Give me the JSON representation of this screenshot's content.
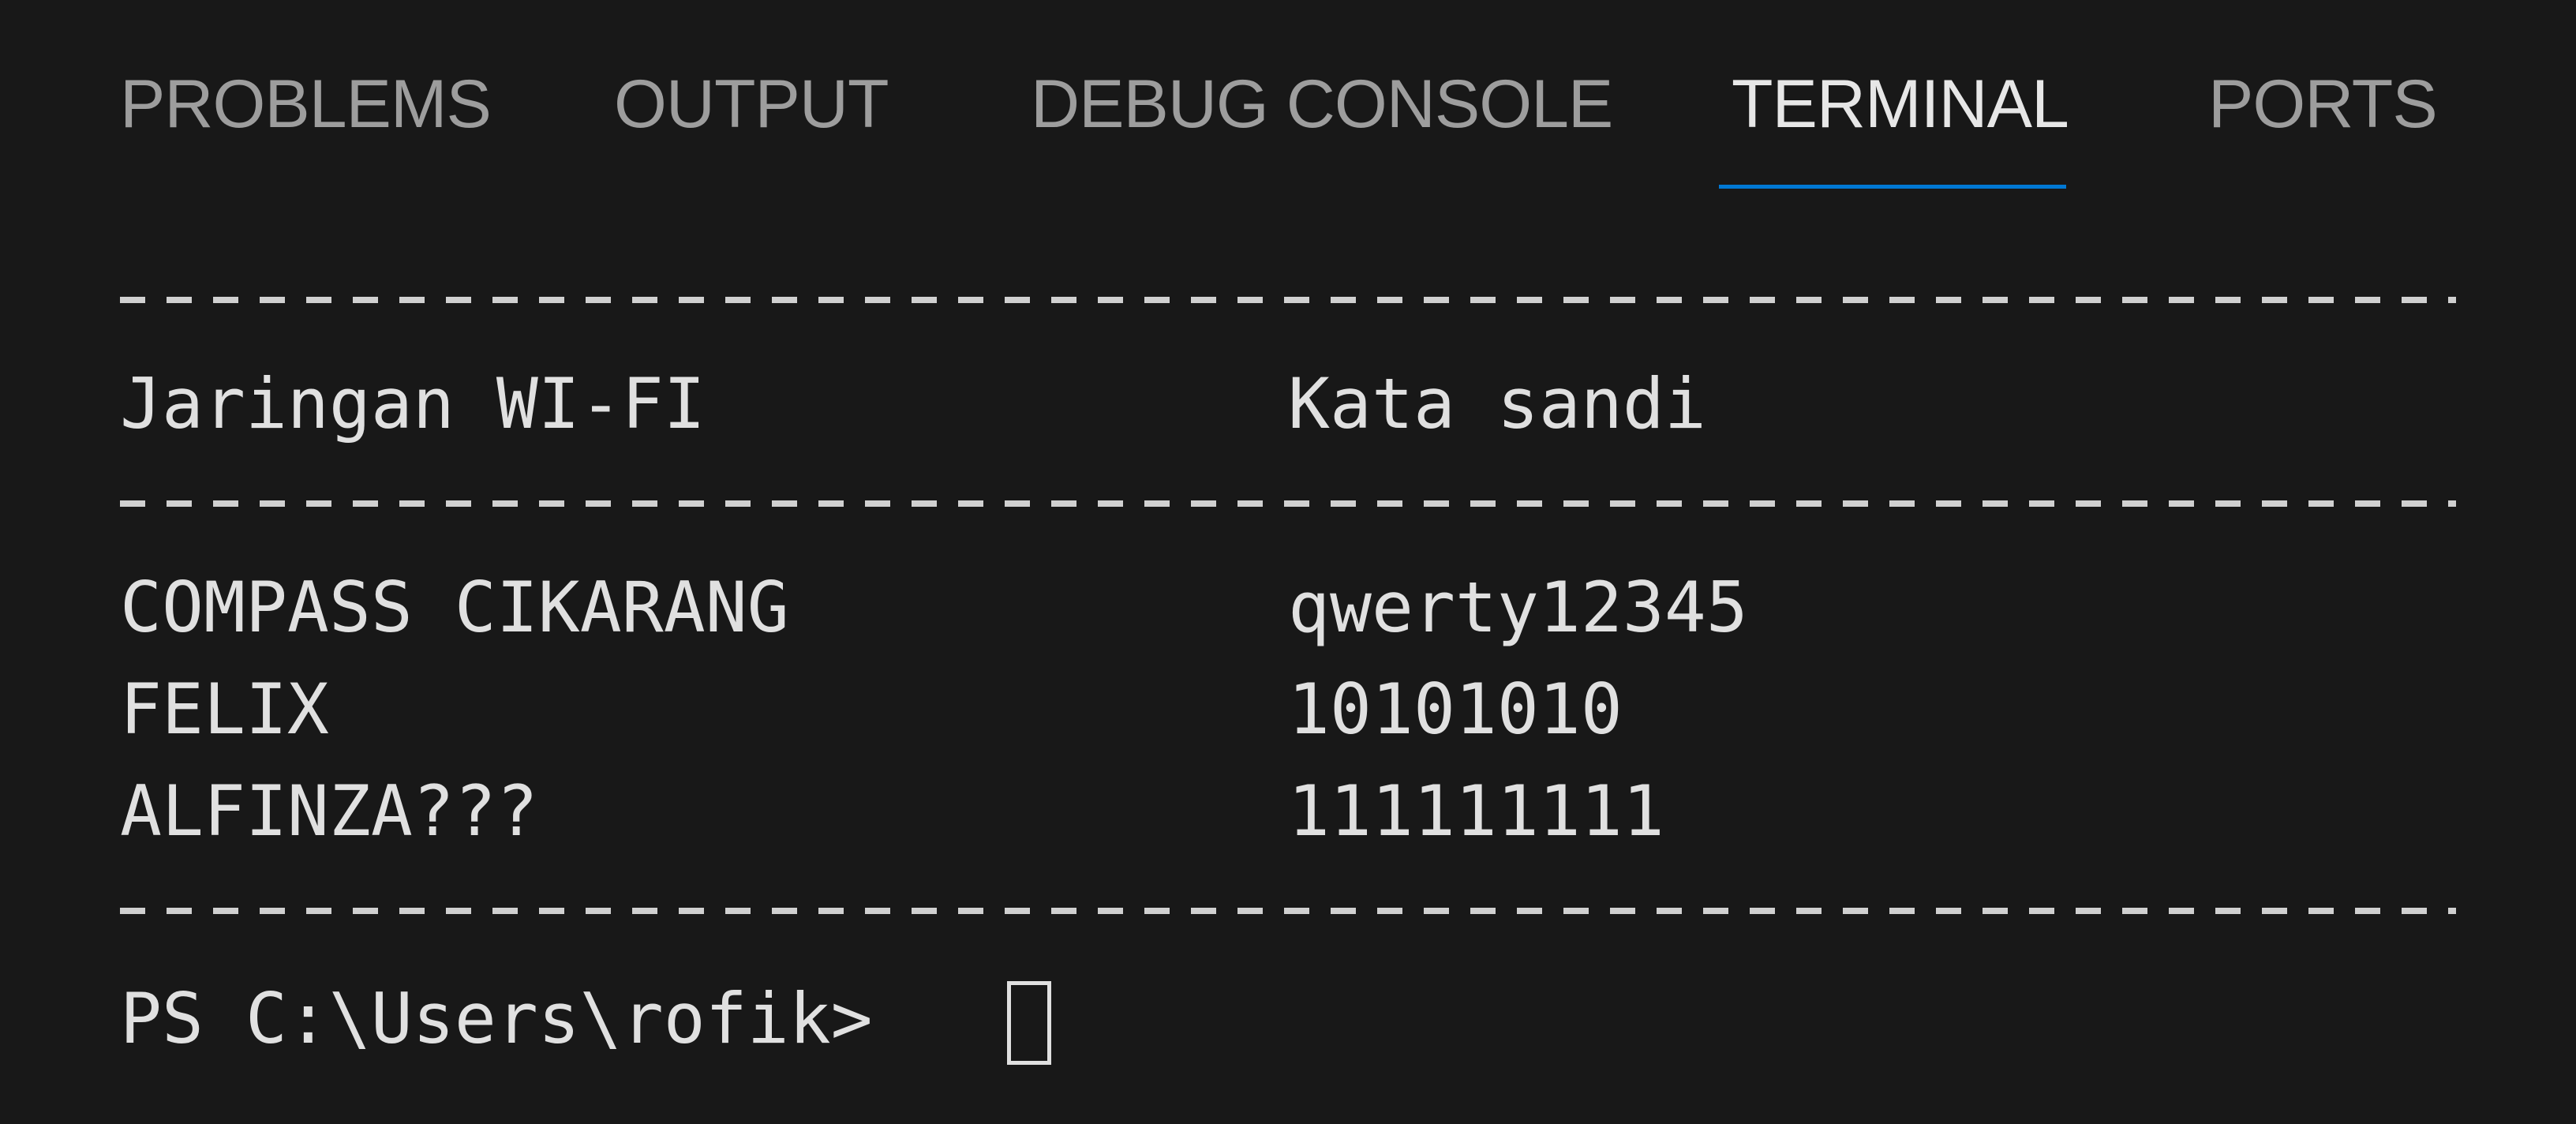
{
  "tabs": [
    {
      "label": "PROBLEMS",
      "active": false
    },
    {
      "label": "OUTPUT",
      "active": false
    },
    {
      "label": "DEBUG CONSOLE",
      "active": false
    },
    {
      "label": "TERMINAL",
      "active": true
    },
    {
      "label": "PORTS",
      "active": false
    }
  ],
  "terminal": {
    "header": {
      "network": "Jaringan WI-FI",
      "password": "Kata sandi"
    },
    "rows": [
      {
        "network": "COMPASS CIKARANG",
        "password": "qwerty12345"
      },
      {
        "network": "FELIX",
        "password": "10101010"
      },
      {
        "network": "ALFINZA???",
        "password": "111111111"
      }
    ],
    "prompt": "PS C:\\Users\\rofik>"
  },
  "colors": {
    "background": "#181818",
    "active_tab_underline": "#0078d4",
    "text": "#e0e0e0",
    "inactive_tab": "#9d9d9d"
  }
}
